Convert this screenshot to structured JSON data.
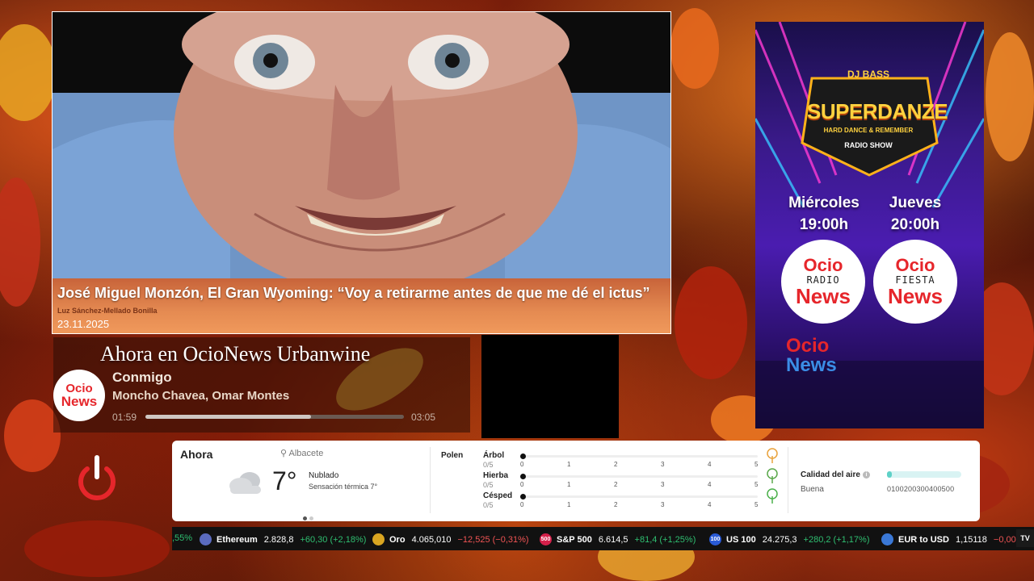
{
  "news": {
    "title": "José Miguel Monzón, El Gran Wyoming: “Voy a retirarme antes de que me dé el ictus”",
    "author": "Luz Sánchez-Mellado Bonilla",
    "date": "23.11.2025"
  },
  "now_playing": {
    "heading": "Ahora en OcioNews Urbanwine",
    "song": "Conmigo",
    "artist": "Moncho Chavea, Omar Montes",
    "elapsed": "01:59",
    "total": "03:05",
    "progress": 0.64,
    "logo_top": "Ocio",
    "logo_bottom": "News"
  },
  "promo": {
    "dj": "DJ BASS",
    "title": "SUPERDANZE",
    "subtitle": "HARD DANCE & REMEMBER",
    "show": "RADIO SHOW",
    "day1": "Miércoles",
    "time1": "19:00h",
    "day2": "Jueves",
    "time2": "20:00h",
    "badge_top": "Ocio",
    "badge1_mid": "RADIO",
    "badge2_mid": "FIESTA",
    "badge_bottom": "News",
    "logo_top": "Ocio",
    "logo_bottom": "News"
  },
  "weather": {
    "now_label": "Ahora",
    "location": "Albacete",
    "temperature": "7°",
    "condition": "Nublado",
    "feels_like": "Sensación térmica 7°",
    "polen_title": "Polen",
    "polen": [
      {
        "name": "Árbol",
        "value": "0/5",
        "level": 0
      },
      {
        "name": "Hierba",
        "value": "0/5",
        "level": 0
      },
      {
        "name": "Césped",
        "value": "0/5",
        "level": 0
      }
    ],
    "polen_scale": [
      "0",
      "1",
      "2",
      "3",
      "4",
      "5"
    ],
    "air_title": "Calidad del aire",
    "air_label": "Buena",
    "air_scale": "0100200300400500",
    "air_level": 0.05
  },
  "ticker": [
    {
      "name": "",
      "price": "",
      "change": ",55%",
      "dir": "up",
      "icon": "partial"
    },
    {
      "name": "Ethereum",
      "price": "2.828,8",
      "change": "+60,30 (+2,18%)",
      "dir": "up",
      "icon": "ethereum-icon"
    },
    {
      "name": "Oro",
      "price": "4.065,010",
      "change": "−12,525 (−0,31%)",
      "dir": "down",
      "icon": "gold-icon"
    },
    {
      "name": "S&P 500",
      "price": "6.614,5",
      "change": "+81,4 (+1,25%)",
      "dir": "up",
      "icon": "sp500-icon",
      "badge": "500"
    },
    {
      "name": "US 100",
      "price": "24.275,3",
      "change": "+280,2 (+1,17%)",
      "dir": "up",
      "icon": "us100-icon",
      "badge": "100"
    },
    {
      "name": "EUR to USD",
      "price": "1,15118",
      "change": "−0,00 (−",
      "dir": "down",
      "icon": "eurusd-icon"
    }
  ],
  "ticker_brand": "TV",
  "colors": {
    "brand_red": "#e6262b",
    "up": "#2fbf71",
    "down": "#f05454"
  }
}
